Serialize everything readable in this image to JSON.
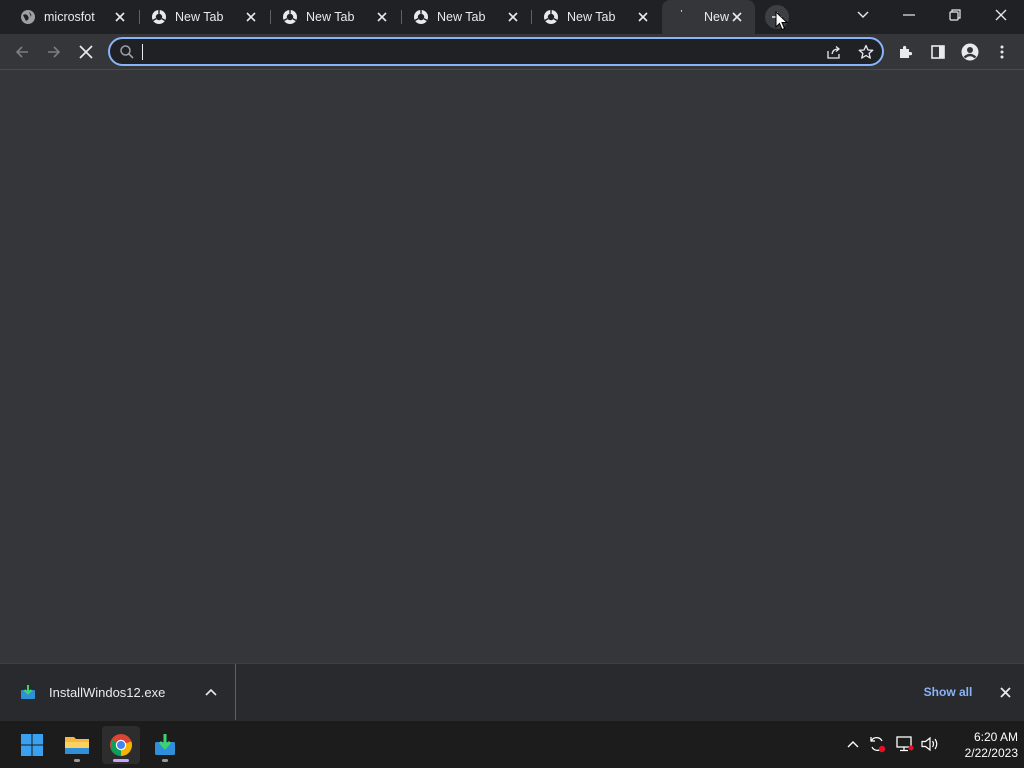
{
  "browser": {
    "tabs": [
      {
        "title": "microsfot",
        "icon": "globe-icon",
        "active": false
      },
      {
        "title": "New Tab",
        "icon": "chrome-icon",
        "active": false
      },
      {
        "title": "New Tab",
        "icon": "chrome-icon",
        "active": false
      },
      {
        "title": "New Tab",
        "icon": "chrome-icon",
        "active": false
      },
      {
        "title": "New Tab",
        "icon": "chrome-icon",
        "active": false
      },
      {
        "title": "New",
        "icon": "loading-spinner-icon",
        "active": true
      }
    ],
    "omnibox": {
      "value": "",
      "placeholder": ""
    },
    "colors": {
      "accent": "#8ab4f8",
      "frame": "#202124",
      "toolbar": "#35363a"
    }
  },
  "download_shelf": {
    "filename": "InstallWindos12.exe",
    "show_all_label": "Show all"
  },
  "taskbar": {
    "apps": [
      "start-icon",
      "file-explorer-icon",
      "chrome-icon",
      "installer-icon"
    ],
    "time": "6:20 AM",
    "date": "2/22/2023"
  }
}
